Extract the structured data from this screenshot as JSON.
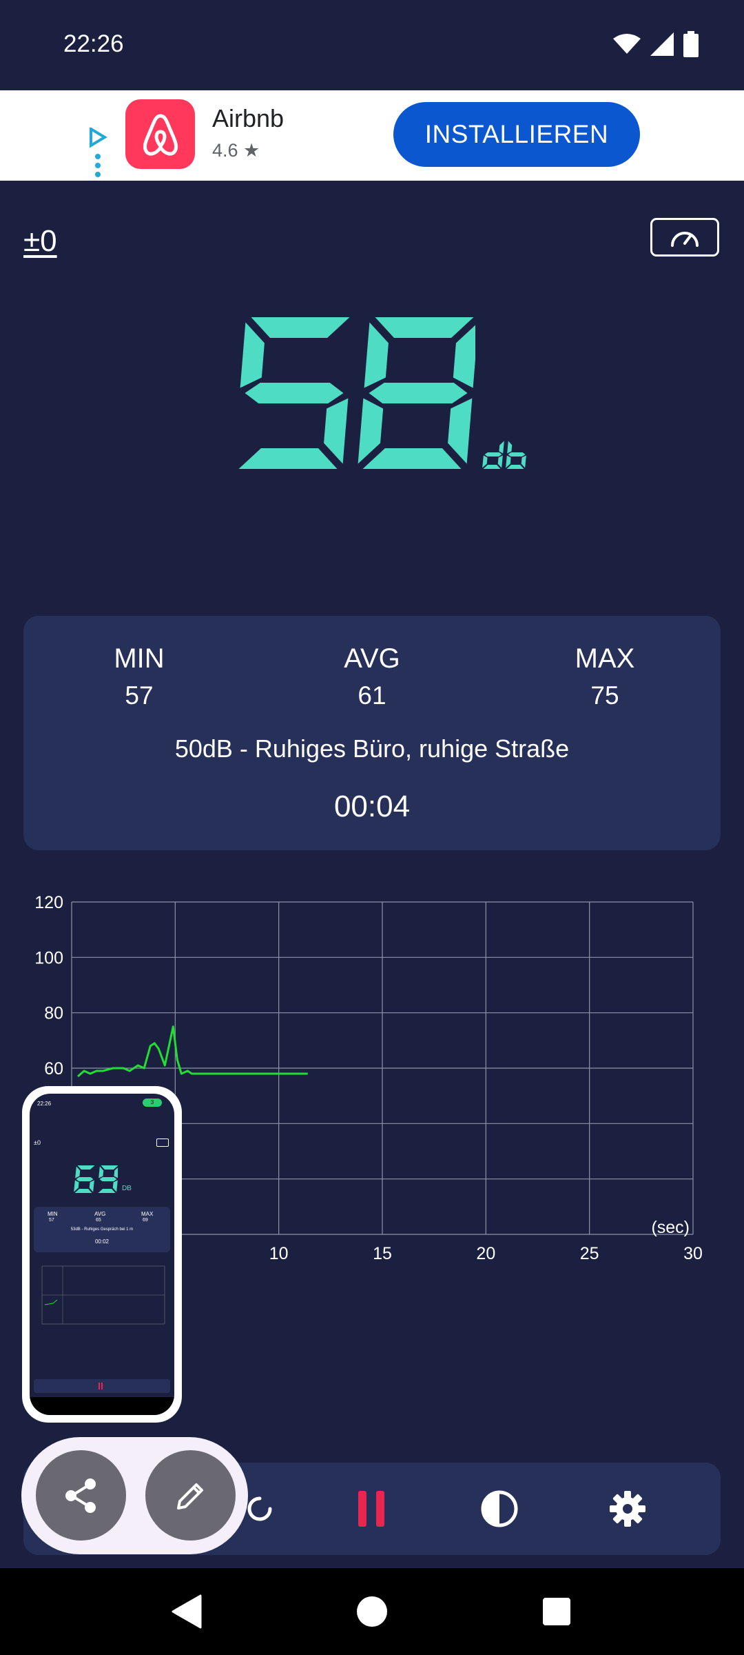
{
  "status": {
    "time": "22:26"
  },
  "ad": {
    "app_name": "Airbnb",
    "rating": "4.6 ★",
    "install_label": "INSTALLIEREN"
  },
  "meter": {
    "calibration": "±0",
    "value": "58",
    "unit": "DB",
    "min_label": "MIN",
    "min_value": "57",
    "avg_label": "AVG",
    "avg_value": "61",
    "max_label": "MAX",
    "max_value": "75",
    "description": "50dB - Ruhiges Büro, ruhige Straße",
    "elapsed": "00:04"
  },
  "chart_data": {
    "type": "line",
    "xlabel": "(sec)",
    "ylabel": "",
    "x_ticks": [
      "10",
      "15",
      "20",
      "25",
      "30"
    ],
    "y_ticks": [
      "120",
      "100",
      "80",
      "60"
    ],
    "xlim": [
      0,
      30
    ],
    "ylim": [
      0,
      120
    ],
    "grid": true,
    "series": [
      {
        "color": "#22dd33",
        "x": [
          0.3,
          0.6,
          0.9,
          1.2,
          1.5,
          2.0,
          2.5,
          2.8,
          3.0,
          3.2,
          3.5,
          3.8,
          4.0,
          4.2,
          4.5,
          4.7,
          4.9,
          5.1,
          5.3,
          5.6,
          5.8,
          6.0,
          6.2,
          6.4,
          6.6,
          6.8,
          7.0,
          7.2,
          7.5,
          7.8,
          8.1,
          8.4,
          8.7,
          9.0,
          9.3,
          9.6,
          9.9,
          10.2,
          10.5,
          10.8,
          11.1,
          11.4
        ],
        "y": [
          57,
          59,
          58,
          59,
          59,
          60,
          60,
          59,
          60,
          61,
          60,
          68,
          69,
          67,
          61,
          68,
          75,
          63,
          58,
          59,
          58,
          58,
          58,
          58,
          58,
          58,
          58,
          58,
          58,
          58,
          58,
          58,
          58,
          58,
          58,
          58,
          58,
          58,
          58,
          58,
          58,
          58
        ]
      }
    ]
  },
  "mini_preview": {
    "time": "22:26",
    "badge": "3",
    "calibration": "±0",
    "value": "69",
    "unit": "DB",
    "min_label": "MIN",
    "avg_label": "AVG",
    "max_label": "MAX",
    "min_value": "57",
    "avg_value": "65",
    "max_value": "69",
    "description": "53dB - Ruhiges Gespräch bei 1 m",
    "elapsed": "00:02"
  },
  "colors": {
    "background": "#1b2040",
    "card": "#273059",
    "digits": "#4fdcc4",
    "pause": "#e8264f",
    "graph": "#22dd33"
  },
  "icons": {
    "gauge": "speedometer-icon",
    "bottom_bar": [
      "reset-icon",
      "pause-icon",
      "contrast-icon",
      "gear-icon"
    ],
    "fab": [
      "share-icon",
      "edit-icon"
    ],
    "nav": [
      "back-icon",
      "home-icon",
      "recents-icon"
    ]
  }
}
